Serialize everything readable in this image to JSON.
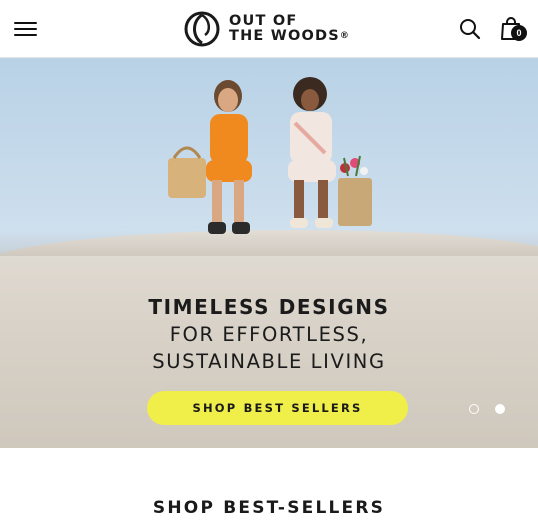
{
  "header": {
    "logo_line1": "OUT OF",
    "logo_line2": "THE WOODS",
    "logo_mark": "®",
    "menu_icon": "hamburger-menu-icon",
    "search_icon": "search-icon",
    "cart_icon": "shopping-bag-icon",
    "cart_count": "0"
  },
  "hero": {
    "headline_line1": "TIMELESS DESIGNS",
    "headline_line2": "FOR EFFORTLESS,",
    "headline_line3": "SUSTAINABLE LIVING",
    "cta_label": "SHOP BEST SELLERS",
    "carousel": {
      "slides": 2,
      "active_slide": 2
    },
    "colors": {
      "cta_background": "#f0ef4a",
      "sky": "#c9dcec"
    }
  },
  "section": {
    "title": "SHOP BEST-SELLERS"
  }
}
